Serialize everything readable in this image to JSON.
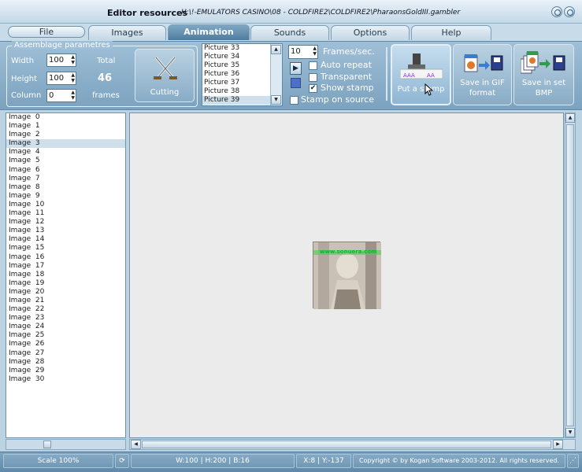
{
  "window": {
    "title": "Editor resources",
    "path": "H:\\!-EMULATORS CASINO\\08 - COLDFIRE2\\COLDFIRE2\\PharaonsGoldIII.gambler"
  },
  "menu": {
    "file": "File",
    "tabs": [
      "Images",
      "Animation",
      "Sounds",
      "Options",
      "Help"
    ],
    "active_tab": "Animation"
  },
  "assemblage": {
    "title": "Assemblage parametres",
    "width_label": "Width",
    "width_value": "100",
    "height_label": "Height",
    "height_value": "100",
    "column_label": "Column",
    "column_value": "0",
    "total_label": "Total",
    "total_value": "46",
    "frames_label": "frames",
    "cutting_label": "Cutting"
  },
  "picture_list": {
    "items": [
      "Picture 33",
      "Picture 34",
      "Picture 35",
      "Picture 36",
      "Picture 37",
      "Picture 38",
      "Picture 39"
    ],
    "selected": "Picture 39"
  },
  "playback": {
    "fps_value": "10",
    "fps_label": "Frames/sec.",
    "auto_repeat": "Auto repeat",
    "transparent": "Transparent",
    "show_stamp": "Show stamp",
    "stamp_on_source": "Stamp on source",
    "show_stamp_checked": true
  },
  "actions": {
    "put_a_stamp": "Put a stamp",
    "save_gif_line1": "Save in GIF",
    "save_gif_line2": "format",
    "save_bmp_line1": "Save in set",
    "save_bmp_line2": "BMP"
  },
  "image_list": {
    "items": [
      "Image  0",
      "Image  1",
      "Image  2",
      "Image  3",
      "Image  4",
      "Image  5",
      "Image  6",
      "Image  7",
      "Image  8",
      "Image  9",
      "Image  10",
      "Image  11",
      "Image  12",
      "Image  13",
      "Image  14",
      "Image  15",
      "Image  16",
      "Image  17",
      "Image  18",
      "Image  19",
      "Image  20",
      "Image  21",
      "Image  22",
      "Image  23",
      "Image  24",
      "Image  25",
      "Image  26",
      "Image  27",
      "Image  28",
      "Image  29",
      "Image  30"
    ],
    "selected_index": 3
  },
  "preview": {
    "watermark": "www.sonuera.com"
  },
  "status": {
    "scale": "Scale 100%",
    "dims": "W:100 | H:200 | B:16",
    "coords": "X:8 | Y:-137",
    "copyright": "Copyright © by Kogan Software 2003-2012. All rights reserved."
  }
}
